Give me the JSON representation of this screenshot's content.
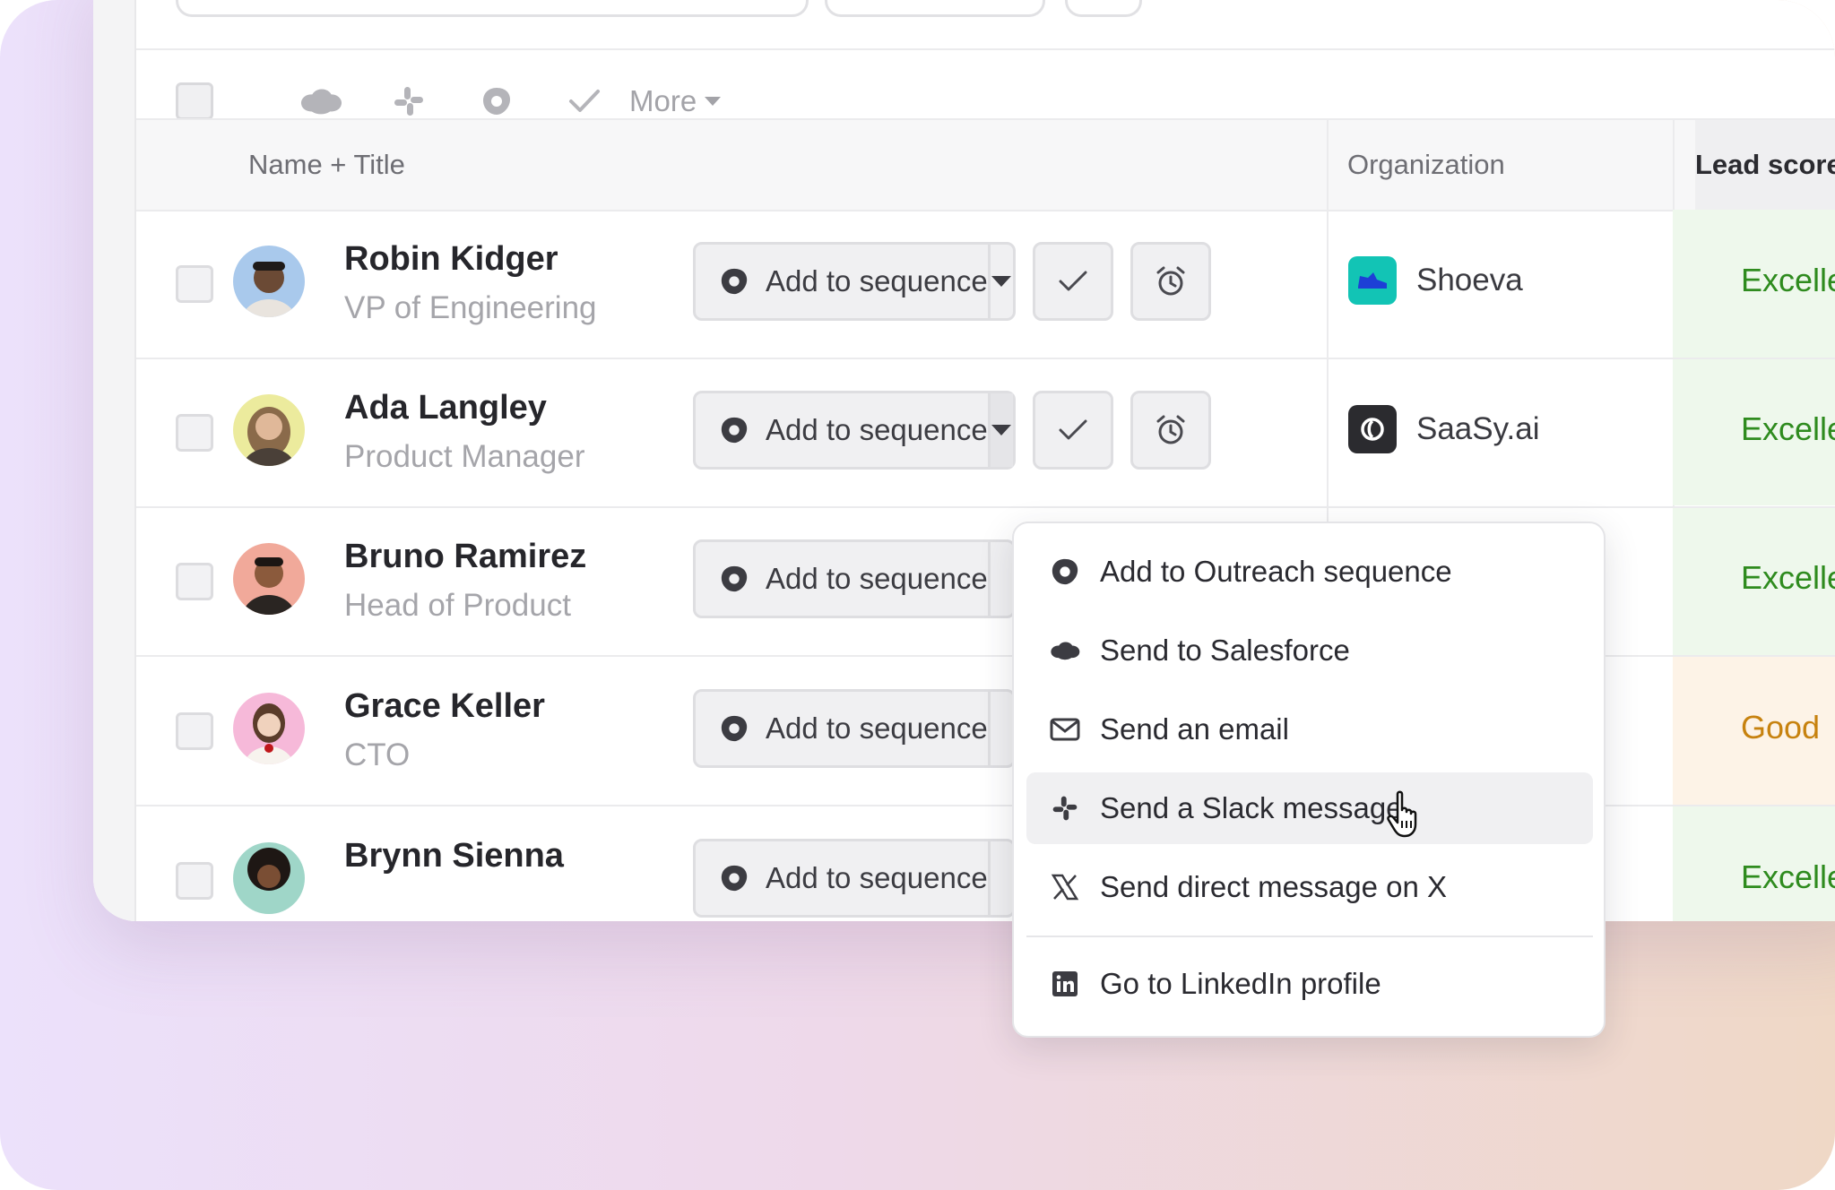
{
  "toolbar": {
    "more_label": "More",
    "icons": [
      "salesforce-icon",
      "slack-icon",
      "outreach-icon",
      "check-icon"
    ]
  },
  "table": {
    "headers": {
      "name_title": "Name + Title",
      "organization": "Organization",
      "lead_score": "Lead score"
    },
    "rows": [
      {
        "name": "Robin Kidger",
        "title": "VP of Engineering",
        "action": "Add to sequence",
        "org": "Shoeva",
        "score": "Excellent"
      },
      {
        "name": "Ada Langley",
        "title": "Product Manager",
        "action": "Add to sequence",
        "org": "SaaSy.ai",
        "score": "Excellent"
      },
      {
        "name": "Bruno Ramirez",
        "title": "Head of Product",
        "action": "Add to sequence",
        "org": "",
        "score": "Excellent"
      },
      {
        "name": "Grace Keller",
        "title": "CTO",
        "action": "Add to sequence",
        "org": "",
        "score": "Good"
      },
      {
        "name": "Brynn Sienna",
        "title": "",
        "action": "Add to sequence",
        "org": "",
        "score": "Excellent"
      }
    ]
  },
  "menu": {
    "items": [
      {
        "label": "Add to Outreach sequence",
        "icon": "outreach-icon"
      },
      {
        "label": "Send to Salesforce",
        "icon": "salesforce-icon"
      },
      {
        "label": "Send an email",
        "icon": "mail-icon"
      },
      {
        "label": "Send a Slack message",
        "icon": "slack-icon"
      },
      {
        "label": "Send direct message on X",
        "icon": "x-icon"
      },
      {
        "label": "Go to LinkedIn profile",
        "icon": "linkedin-icon"
      }
    ]
  },
  "colors": {
    "excellent_text": "#2e8b1e",
    "excellent_bg": "#eef8ec",
    "good_text": "#c7820f",
    "good_bg": "#fdf3e7",
    "shoeva_logo": "#12c4b5",
    "saasy_logo": "#2b2b2f"
  }
}
